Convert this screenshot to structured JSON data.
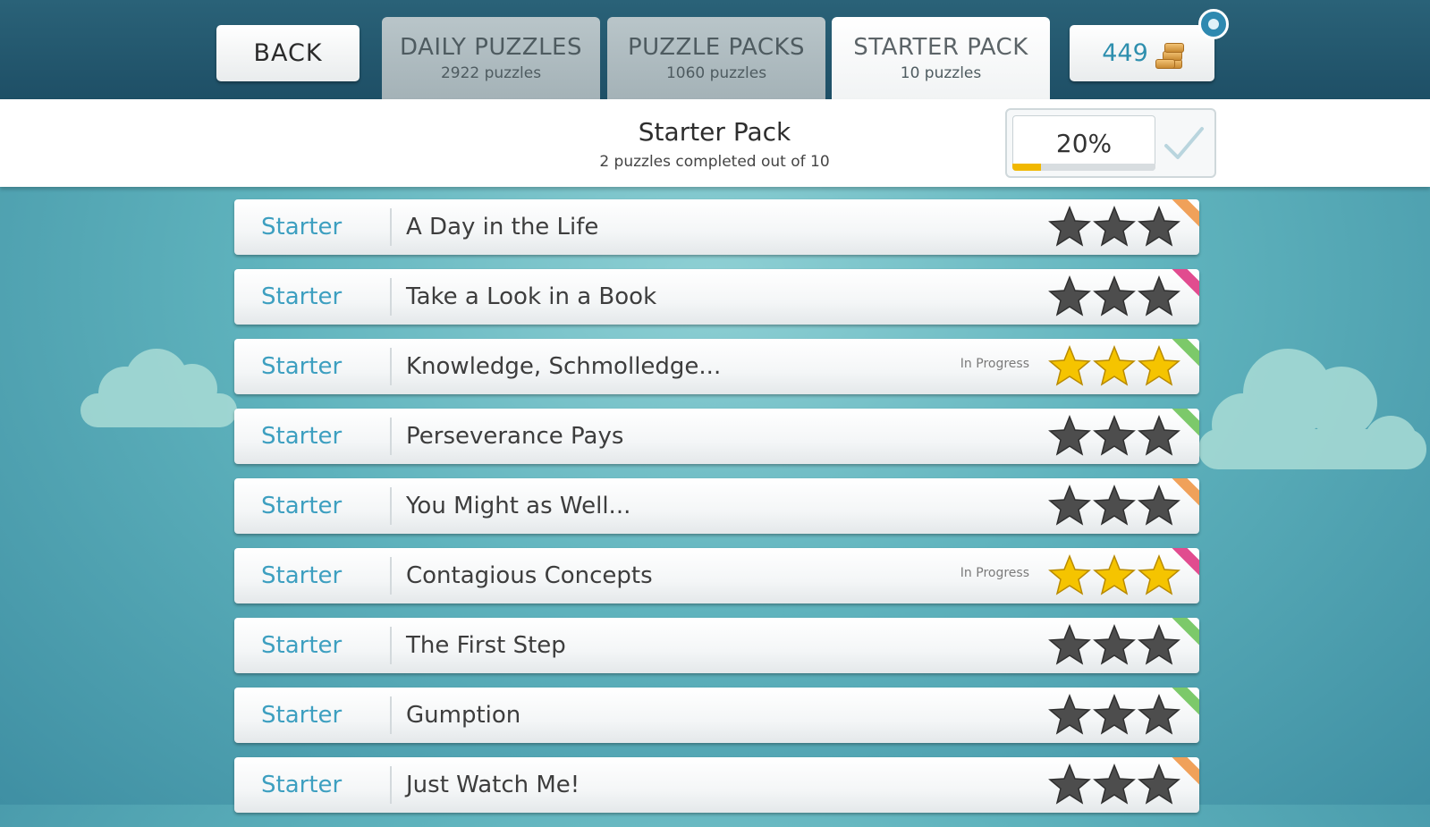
{
  "topbar": {
    "back_label": "BACK",
    "tabs": [
      {
        "title": "DAILY PUZZLES",
        "sub": "2922 puzzles"
      },
      {
        "title": "PUZZLE PACKS",
        "sub": "1060 puzzles"
      },
      {
        "title": "STARTER PACK",
        "sub": "10 puzzles"
      }
    ],
    "coins": "449"
  },
  "header": {
    "title": "Starter Pack",
    "subtitle": "2 puzzles completed out of 10",
    "progress_text": "20%",
    "progress_value": 0.2
  },
  "colors": {
    "star_gold": "#f5c400",
    "star_gray": "#4d4d4d",
    "ribbon_orange": "#f0a15a",
    "ribbon_pink": "#e14c8f",
    "ribbon_green": "#7cc96a",
    "accent_blue": "#3d9fc0"
  },
  "puzzles": [
    {
      "pack": "Starter",
      "name": "A Day in the Life",
      "status": "",
      "stars": "gray",
      "ribbon": "orange"
    },
    {
      "pack": "Starter",
      "name": "Take a Look in a Book",
      "status": "",
      "stars": "gray",
      "ribbon": "pink"
    },
    {
      "pack": "Starter",
      "name": "Knowledge, Schmolledge...",
      "status": "In Progress",
      "stars": "gold",
      "ribbon": "green"
    },
    {
      "pack": "Starter",
      "name": "Perseverance Pays",
      "status": "",
      "stars": "gray",
      "ribbon": "green"
    },
    {
      "pack": "Starter",
      "name": "You Might as Well...",
      "status": "",
      "stars": "gray",
      "ribbon": "orange"
    },
    {
      "pack": "Starter",
      "name": "Contagious Concepts",
      "status": "In Progress",
      "stars": "gold",
      "ribbon": "pink"
    },
    {
      "pack": "Starter",
      "name": "The First Step",
      "status": "",
      "stars": "gray",
      "ribbon": "green"
    },
    {
      "pack": "Starter",
      "name": "Gumption",
      "status": "",
      "stars": "gray",
      "ribbon": "green"
    },
    {
      "pack": "Starter",
      "name": "Just Watch Me!",
      "status": "",
      "stars": "gray",
      "ribbon": "orange"
    }
  ]
}
